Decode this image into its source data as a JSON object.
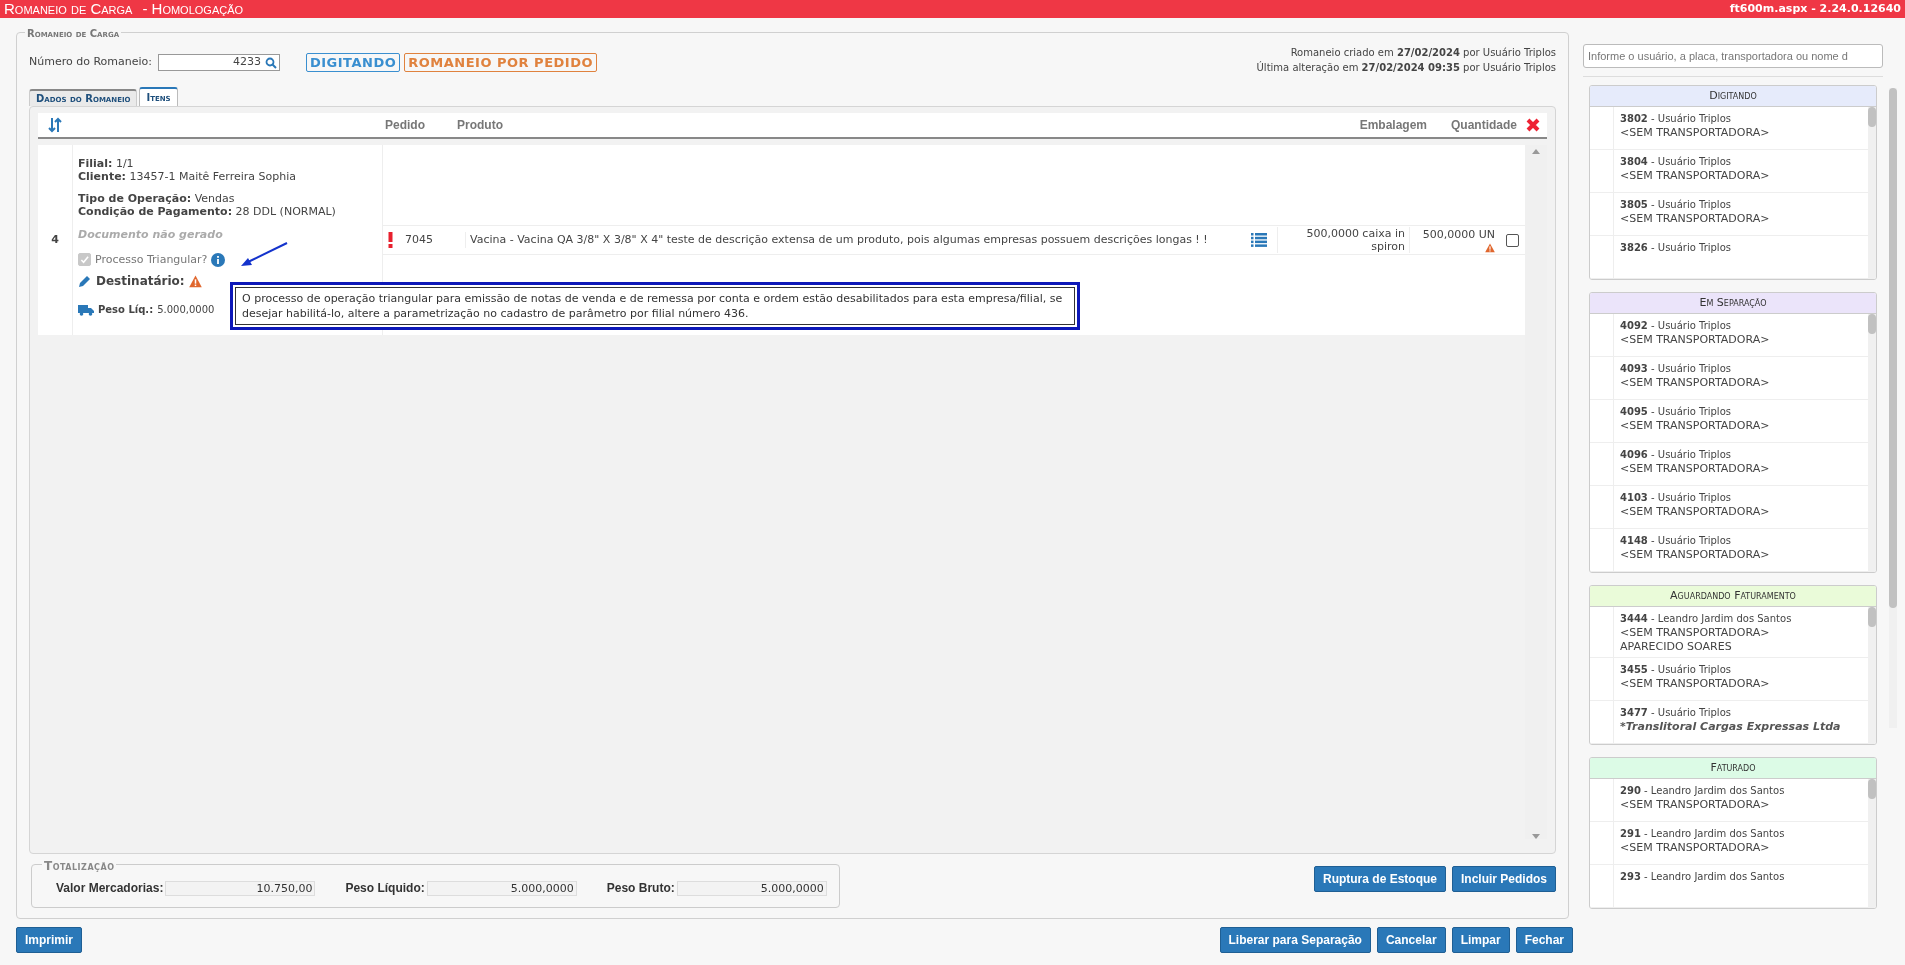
{
  "window": {
    "title": "Romaneio de Carga",
    "environment": "- Homologação",
    "version": "ft600m.aspx - 2.24.0.12640"
  },
  "form": {
    "legend": "Romaneio de Carga",
    "number_label": "Número do Romaneio:",
    "number_value": "4233",
    "badges": [
      {
        "text": "DIGITANDO",
        "color": "#3a8fd0"
      },
      {
        "text": "ROMANEIO POR PEDIDO",
        "color": "#e0823e"
      }
    ],
    "audit": [
      "Romaneio criado em **27/02/2024** por Usuário Triplos",
      "Última alteração em **27/02/2024 09:35** por Usuário Triplos"
    ]
  },
  "tabs": [
    {
      "label": "Dados do Romaneio",
      "selected": false
    },
    {
      "label": "Itens",
      "selected": true
    }
  ],
  "table": {
    "columns": [
      "Pedido",
      "Produto",
      "Embalagem",
      "Quantidade"
    ],
    "rows": [
      {
        "number": "4",
        "detail_groups": [
          [
            "**Filial:** 1/1",
            "**Cliente:** 13457-1 Maitê Ferreira Sophia"
          ],
          [
            "**Tipo de Operação:** Vendas",
            "**Condição de Pagamento:** 28 DDL (NORMAL)"
          ]
        ],
        "document_status": "Documento não gerado",
        "triangular": {
          "label": "Processo Triangular?",
          "checked": true,
          "disabled": true
        },
        "recipient_label": "Destinatário:",
        "weight_label": "Peso Líq.:",
        "weight_value": "5.000,0000",
        "items": [
          {
            "pedido": "7045",
            "produto": "Vacina - Vacina QA 3/8\" X 3/8\" X 4\" teste de descrição extensa de um produto, pois algumas empresas possuem descrições longas ! !",
            "embalagem": "500,0000 caixa in spiron",
            "quantidade": "500,0000 UN",
            "alert": true,
            "warning": true,
            "checked": false
          }
        ]
      }
    ]
  },
  "tooltip": {
    "text": "O processo de operação triangular para emissão de notas de venda e de remessa por conta e ordem estão desabilitados para esta empresa/filial, se desejar habilitá-lo, altere a parametrização no cadastro de parâmetro por filial número 436."
  },
  "totals": {
    "legend": "Totalização",
    "fields": [
      {
        "label": "Valor Mercadorias:",
        "value": "10.750,00"
      },
      {
        "label": "Peso Líquido:",
        "value": "5.000,0000"
      },
      {
        "label": "Peso Bruto:",
        "value": "5.000,0000"
      }
    ]
  },
  "actions": [
    "Ruptura de Estoque",
    "Incluir Pedidos"
  ],
  "footer_left": [
    "Imprimir"
  ],
  "footer_right": [
    "Liberar para Separação",
    "Cancelar",
    "Limpar",
    "Fechar"
  ],
  "sidebar": {
    "search_placeholder": "Informe o usuário, a placa, transportadora ou nome d",
    "groups": [
      {
        "title": "Digitando",
        "color": "#e6ebfb",
        "items": [
          {
            "title": "**3802** - Usuário Triplos",
            "lines": [
              {
                "kind": "plain",
                "text": "<SEM TRANSPORTADORA>"
              }
            ]
          },
          {
            "title": "**3804** - Usuário Triplos",
            "lines": [
              {
                "kind": "plain",
                "text": "<SEM TRANSPORTADORA>"
              }
            ]
          },
          {
            "title": "**3805** - Usuário Triplos",
            "lines": [
              {
                "kind": "plain",
                "text": "<SEM TRANSPORTADORA>"
              }
            ]
          },
          {
            "title": "**3826** - Usuário Triplos"
          }
        ]
      },
      {
        "title": "Em Separação",
        "color": "#ebe4fa",
        "items": [
          {
            "title": "**4092** - Usuário Triplos",
            "lines": [
              {
                "kind": "plain",
                "text": "<SEM TRANSPORTADORA>"
              }
            ]
          },
          {
            "title": "**4093** - Usuário Triplos",
            "lines": [
              {
                "kind": "plain",
                "text": "<SEM TRANSPORTADORA>"
              }
            ]
          },
          {
            "title": "**4095** - Usuário Triplos",
            "lines": [
              {
                "kind": "plain",
                "text": "<SEM TRANSPORTADORA>"
              }
            ]
          },
          {
            "title": "**4096** - Usuário Triplos",
            "lines": [
              {
                "kind": "plain",
                "text": "<SEM TRANSPORTADORA>"
              }
            ]
          },
          {
            "title": "**4103** - Usuário Triplos",
            "lines": [
              {
                "kind": "plain",
                "text": "<SEM TRANSPORTADORA>"
              }
            ]
          },
          {
            "title": "**4148** - Usuário Triplos",
            "lines": [
              {
                "kind": "plain",
                "text": "<SEM TRANSPORTADORA>"
              }
            ]
          }
        ]
      },
      {
        "title": "Aguardando Faturamento",
        "color": "#eafbd9",
        "items": [
          {
            "title": "**3444** - Leandro Jardim dos Santos",
            "lines": [
              {
                "kind": "plain",
                "text": "<SEM TRANSPORTADORA>"
              },
              {
                "kind": "plain",
                "text": "APARECIDO SOARES"
              }
            ]
          },
          {
            "title": "**3455** - Usuário Triplos",
            "lines": [
              {
                "kind": "plain",
                "text": "<SEM TRANSPORTADORA>"
              }
            ]
          },
          {
            "title": "**3477** - Usuário Triplos",
            "lines": [
              {
                "kind": "emphasis",
                "text": "*Translitoral Cargas Expressas Ltda"
              }
            ]
          }
        ]
      },
      {
        "title": "Faturado",
        "color": "#dcfbe6",
        "items": [
          {
            "title": "**290** - Leandro Jardim dos Santos",
            "lines": [
              {
                "kind": "plain",
                "text": "<SEM TRANSPORTADORA>"
              }
            ]
          },
          {
            "title": "**291** - Leandro Jardim dos Santos",
            "lines": [
              {
                "kind": "plain",
                "text": "<SEM TRANSPORTADORA>"
              }
            ]
          },
          {
            "title": "**293** - Leandro Jardim dos Santos"
          }
        ]
      }
    ]
  }
}
